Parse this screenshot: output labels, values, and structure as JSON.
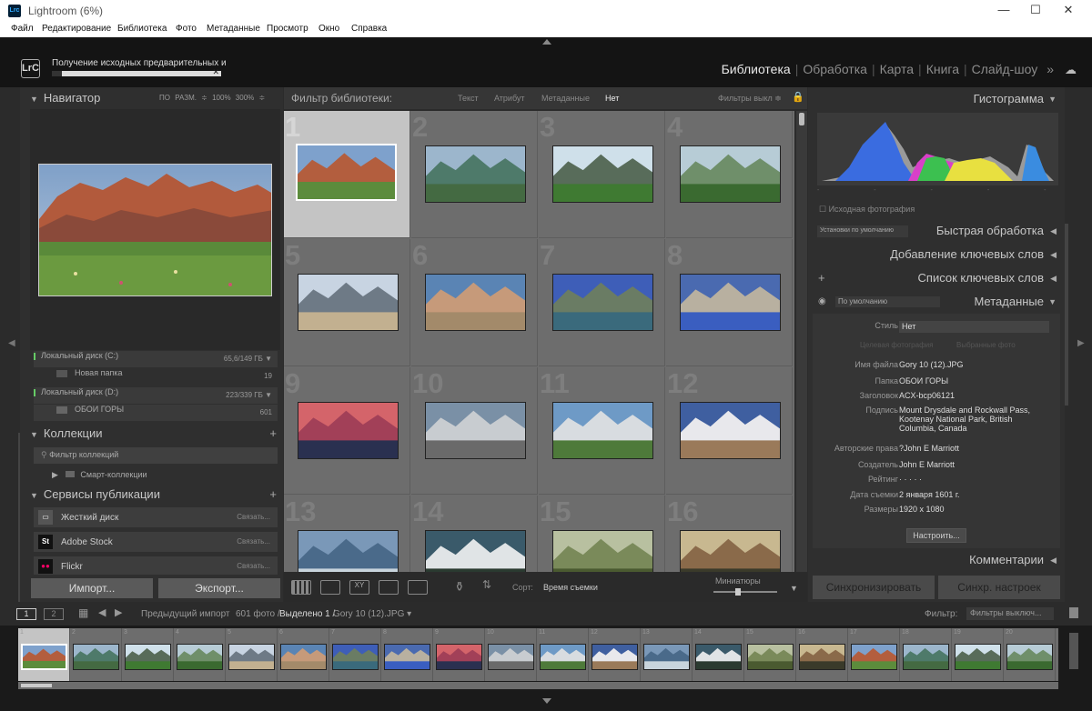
{
  "window": {
    "title": "Lightroom (6%)",
    "logo": "Lrc"
  },
  "menu": [
    "Файл",
    "Редактирование",
    "Библиотека",
    "Фото",
    "Метаданные",
    "Просмотр",
    "Окно",
    "Справка"
  ],
  "progress": {
    "text": "Получение исходных предварительных и",
    "percent": 6
  },
  "lrc_badge": "LrC",
  "modules": [
    "Библиотека",
    "Обработка",
    "Карта",
    "Книга",
    "Слайд-шоу"
  ],
  "modules_more": "»",
  "left": {
    "navigator": {
      "title": "Навигатор",
      "sizes": "ПО РАЗМ. ≑   100%   300% ≑"
    },
    "folders": [
      {
        "label": "Локальный диск (C:)",
        "info": "65,6/149 ГБ ▼",
        "disk": true
      },
      {
        "label": "Новая папка",
        "info": "19",
        "disk": false
      },
      {
        "label": "Локальный диск (D:)",
        "info": "223/339 ГБ ▼",
        "disk": true
      },
      {
        "label": "ОБОИ ГОРЫ",
        "info": "601",
        "disk": false
      }
    ],
    "collections": {
      "title": "Коллекции",
      "filter": "Фильтр коллекций",
      "smart": "Смарт-коллекции"
    },
    "publish": {
      "title": "Сервисы публикации",
      "items": [
        {
          "label": "Жесткий диск",
          "action": "Связать..."
        },
        {
          "label": "Adobe Stock",
          "action": "Связать..."
        },
        {
          "label": "Flickr",
          "action": "Связать..."
        }
      ]
    },
    "import": "Импорт...",
    "export": "Экспорт..."
  },
  "filterbar": {
    "title": "Фильтр библиотеки:",
    "text": "Текст",
    "attr": "Атрибут",
    "meta": "Метаданные",
    "none": "Нет",
    "filters_off": "Фильтры выкл ≑"
  },
  "grid_numbers": [
    "1",
    "2",
    "3",
    "4",
    "5",
    "6",
    "7",
    "8",
    "9",
    "10",
    "11",
    "12",
    "13",
    "14",
    "15",
    "16"
  ],
  "toolbar": {
    "sort_label": "Сорт:",
    "sort_value": "Время съемки",
    "thumbs": "Миниатюры"
  },
  "right": {
    "histogram": "Гистограмма",
    "original": "Исходная фотография",
    "quick": "Быстрая обработка",
    "quick_preset": "Установки по умолчанию",
    "kw_add": "Добавление ключевых слов",
    "kw_list": "Список ключевых слов",
    "meta_title": "Метаданные",
    "meta_preset": "По умолчанию",
    "style_k": "Стиль",
    "style_v": "Нет",
    "target": "Целевая фотография",
    "selected": "Выбранные фото",
    "fields": [
      {
        "k": "Имя файла",
        "v": "Gory 10 (12).JPG"
      },
      {
        "k": "Папка",
        "v": "ОБОИ ГОРЫ"
      },
      {
        "k": "Заголовок",
        "v": "ACX-bcp06121"
      },
      {
        "k": "Подпись",
        "v": "Mount Drysdale and Rockwall Pass, Kootenay National Park, British Columbia, Canada"
      },
      {
        "k": "Авторские права",
        "v": "?John E Marriott"
      },
      {
        "k": "Создатель",
        "v": "John E Marriott"
      },
      {
        "k": "Рейтинг",
        "v": "·   ·   ·   ·   ·"
      },
      {
        "k": "Дата съемки",
        "v": "2 января 1601 г."
      },
      {
        "k": "Размеры",
        "v": "1920 x 1080"
      }
    ],
    "configure": "Настроить...",
    "comments": "Комментарии",
    "sync": "Синхронизировать",
    "sync_settings": "Синхр. настроек"
  },
  "filmbar": {
    "p1": "1",
    "p2": "2",
    "source": "Предыдущий импорт",
    "count": "601 фото /",
    "selected": "Выделено 1 /",
    "file": "Gory 10 (12).JPG ▾",
    "filter_label": "Фильтр:",
    "filter_value": "Фильтры выключ..."
  },
  "film_numbers": [
    "1",
    "2",
    "3",
    "4",
    "5",
    "6",
    "7",
    "8",
    "9",
    "10",
    "11",
    "12",
    "13",
    "14",
    "15",
    "16",
    "17",
    "18",
    "19",
    "20"
  ]
}
